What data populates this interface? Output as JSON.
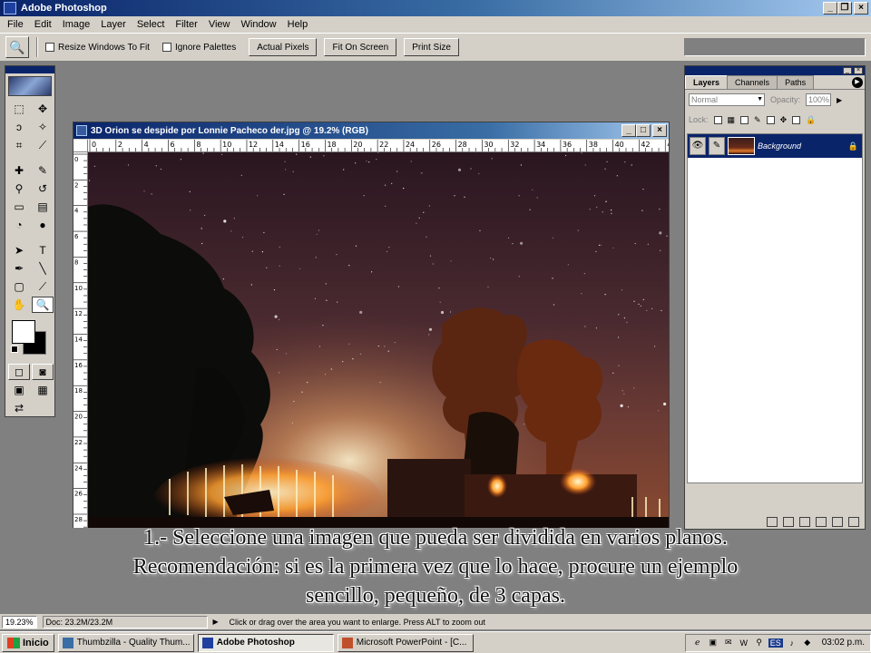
{
  "app": {
    "title": "Adobe Photoshop"
  },
  "menu": [
    "File",
    "Edit",
    "Image",
    "Layer",
    "Select",
    "Filter",
    "View",
    "Window",
    "Help"
  ],
  "options": {
    "resize_windows": "Resize Windows To Fit",
    "ignore_palettes": "Ignore Palettes",
    "actual_pixels": "Actual Pixels",
    "fit_on_screen": "Fit On Screen",
    "print_size": "Print Size"
  },
  "document": {
    "title": "3D Orion se despide por Lonnie Pacheco der.jpg @ 19.2% (RGB)",
    "ruler_h": [
      "0",
      "2",
      "4",
      "6",
      "8",
      "10",
      "12",
      "14",
      "16",
      "18",
      "20",
      "22",
      "24",
      "26",
      "28",
      "30",
      "32",
      "34",
      "36",
      "38",
      "40",
      "42",
      "44"
    ],
    "ruler_v": [
      "0",
      "2",
      "4",
      "6",
      "8",
      "10",
      "12",
      "14",
      "16",
      "18",
      "20",
      "22",
      "24",
      "26",
      "28"
    ]
  },
  "layers": {
    "tabs": [
      "Layers",
      "Channels",
      "Paths"
    ],
    "blend_mode": "Normal",
    "opacity_label": "Opacity:",
    "opacity_value": "100%",
    "lock_label": "Lock:",
    "layer_name": "Background"
  },
  "status": {
    "zoom": "19.23%",
    "doc": "Doc: 23.2M/23.2M",
    "hint": "Click or drag over the area you want to enlarge. Press ALT to zoom out"
  },
  "caption": {
    "line1": "1.- Seleccione una imagen que pueda ser dividida en varios planos.",
    "line2": "Recomendación:  si es la primera vez que lo hace, procure un ejemplo",
    "line3": "sencillo, pequeño,  de 3 capas."
  },
  "taskbar": {
    "start": "Inicio",
    "items": [
      "Thumbzilla - Quality Thum...",
      "Adobe Photoshop",
      "Microsoft PowerPoint - [C..."
    ],
    "lang": "ES",
    "clock": "03:02 p.m."
  },
  "icons": {
    "app": "photoshop-icon",
    "zoom_tool": "magnifier-icon",
    "layer_visibility": "eye-icon",
    "layer_brush": "brush-icon",
    "layer_lock": "lock-icon",
    "palette_menu": "triangle-right-icon"
  },
  "colors": {
    "titlebar": "#0a246a",
    "face": "#d4d0c8",
    "workspace": "#808080",
    "selection": "#0a246a"
  }
}
